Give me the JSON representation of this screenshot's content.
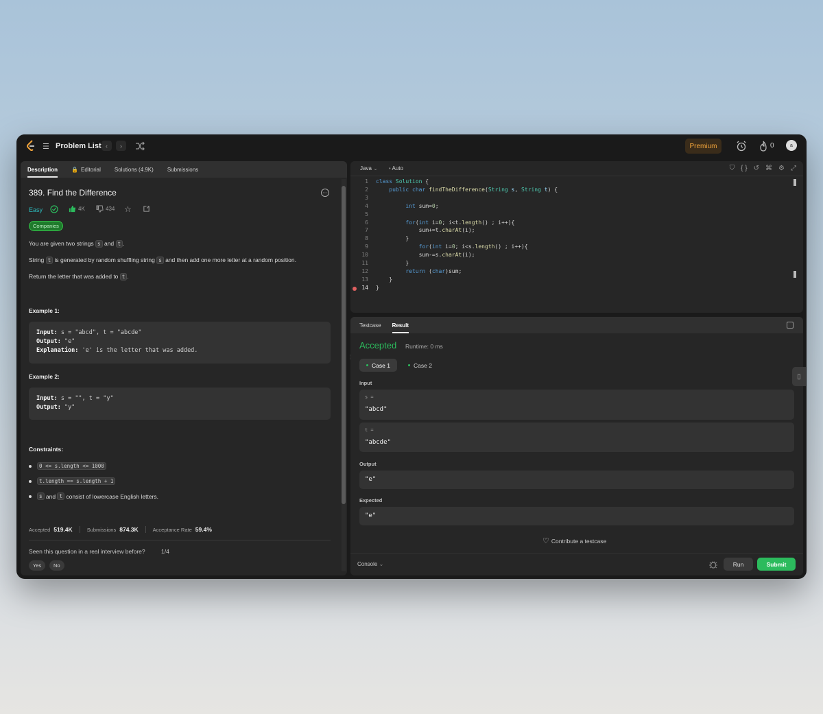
{
  "topbar": {
    "problem_list_label": "Problem List",
    "premium_label": "Premium",
    "streak_count": "0",
    "avatar_text": "a"
  },
  "left_tabs": [
    {
      "label": "Description",
      "active": true
    },
    {
      "label": "Editorial",
      "active": false
    },
    {
      "label": "Solutions (4.9K)",
      "active": false
    },
    {
      "label": "Submissions",
      "active": false
    }
  ],
  "problem": {
    "title": "389. Find the Difference",
    "difficulty": "Easy",
    "likes": "4K",
    "dislikes": "434",
    "companies_label": "Companies",
    "desc1_a": "You are given two strings",
    "desc1_s": "s",
    "desc1_and": "and",
    "desc1_t": "t",
    "desc1_end": ".",
    "desc2_a": "String",
    "desc2_t": "t",
    "desc2_b": "is generated by random shuffling string",
    "desc2_s": "s",
    "desc2_c": "and then add one more letter at a random position.",
    "desc3_a": "Return the letter that was added to",
    "desc3_t": "t",
    "desc3_end": ".",
    "example1_heading": "Example 1:",
    "example1_input_label": "Input:",
    "example1_input": "s = \"abcd\", t = \"abcde\"",
    "example1_output_label": "Output:",
    "example1_output": "\"e\"",
    "example1_expl_label": "Explanation:",
    "example1_expl": "'e' is the letter that was added.",
    "example2_heading": "Example 2:",
    "example2_input_label": "Input:",
    "example2_input": "s = \"\", t = \"y\"",
    "example2_output_label": "Output:",
    "example2_output": "\"y\"",
    "constraints_heading": "Constraints:",
    "constraint1": "0 <= s.length <= 1000",
    "constraint2": "t.length == s.length + 1",
    "constraint3_s": "s",
    "constraint3_and": "and",
    "constraint3_t": "t",
    "constraint3_rest": "consist of lowercase English letters."
  },
  "stats": {
    "accepted_label": "Accepted",
    "accepted_value": "519.4K",
    "submissions_label": "Submissions",
    "submissions_value": "874.3K",
    "rate_label": "Acceptance Rate",
    "rate_value": "59.4%"
  },
  "interview": {
    "question": "Seen this question in a real interview before?",
    "count": "1/4",
    "yes": "Yes",
    "no": "No"
  },
  "editor": {
    "language": "Java",
    "mode": "Auto",
    "lines": [
      {
        "n": "1"
      },
      {
        "n": "2"
      },
      {
        "n": "3"
      },
      {
        "n": "4"
      },
      {
        "n": "5"
      },
      {
        "n": "6"
      },
      {
        "n": "7"
      },
      {
        "n": "8"
      },
      {
        "n": "9"
      },
      {
        "n": "10"
      },
      {
        "n": "11"
      },
      {
        "n": "12"
      },
      {
        "n": "13"
      },
      {
        "n": "14"
      }
    ]
  },
  "result": {
    "tabs": [
      "Testcase",
      "Result"
    ],
    "status": "Accepted",
    "runtime": "Runtime: 0 ms",
    "case1": "Case 1",
    "case2": "Case 2",
    "input_label": "Input",
    "input_s_label": "s =",
    "input_s_value": "\"abcd\"",
    "input_t_label": "t =",
    "input_t_value": "\"abcde\"",
    "output_label": "Output",
    "output_value": "\"e\"",
    "expected_label": "Expected",
    "expected_value": "\"e\"",
    "contribute": "Contribute a testcase"
  },
  "console_bar": {
    "console_label": "Console",
    "run_label": "Run",
    "submit_label": "Submit"
  },
  "colors": {
    "accent_green": "#2cbb5d",
    "easy_teal": "#2cbbbd",
    "premium_orange": "#f0a33a"
  }
}
